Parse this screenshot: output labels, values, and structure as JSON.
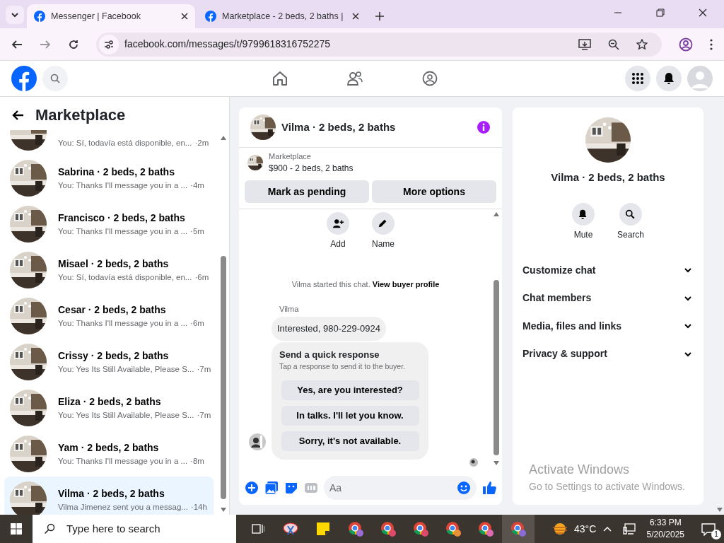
{
  "browser": {
    "tabs": [
      {
        "title": "Messenger | Facebook",
        "selected": true
      },
      {
        "title": "Marketplace - 2 beds, 2 baths |",
        "selected": false
      }
    ],
    "url": "facebook.com/messages/t/9799618316752275"
  },
  "sidebar": {
    "title": "Marketplace",
    "conversations": [
      {
        "preview": "You: Sí, todavía está disponible, en...",
        "time": "·2m",
        "selected": false
      },
      {
        "name": "Sabrina · 2 beds, 2 baths",
        "preview": "You: Thanks I'll message you in a ...",
        "time": "·4m",
        "selected": false
      },
      {
        "name": "Francisco · 2 beds, 2 baths",
        "preview": "You: Thanks I'll message you in a ...",
        "time": "·5m",
        "selected": false
      },
      {
        "name": "Misael · 2 beds, 2 baths",
        "preview": "You: Sí, todavía está disponible, en...",
        "time": "·6m",
        "selected": false
      },
      {
        "name": "Cesar · 2 beds, 2 baths",
        "preview": "You: Thanks I'll message you in a ...",
        "time": "·6m",
        "selected": false
      },
      {
        "name": "Crissy · 2 beds, 2 baths",
        "preview": "You: Yes Its Still Available, Please S...",
        "time": "·7m",
        "selected": false
      },
      {
        "name": "Eliza · 2 beds, 2 baths",
        "preview": "You: Yes Its Still Available, Please S...",
        "time": "·7m",
        "selected": false
      },
      {
        "name": "Yam · 2 beds, 2 baths",
        "preview": "You: Thanks I'll message you in a ...",
        "time": "·8m",
        "selected": false
      },
      {
        "name": "Vilma · 2 beds, 2 baths",
        "preview": "Vilma Jimenez sent you a messag...",
        "time": "·14h",
        "selected": true
      }
    ]
  },
  "chat": {
    "title": "Vilma · 2 beds, 2 baths",
    "listing": {
      "label": "Marketplace",
      "price": "$900 - 2 beds, 2 baths"
    },
    "buttons": [
      "Mark as pending",
      "More options"
    ],
    "actions": [
      {
        "kind": "add",
        "label": "Add"
      },
      {
        "kind": "name",
        "label": "Name"
      }
    ],
    "notice": {
      "text": "Vilma started this chat.",
      "link": "View buyer profile"
    },
    "sender": "Vilma",
    "message": "Interested, 980-229-0924",
    "quick_response": {
      "title": "Send a quick response",
      "subtitle": "Tap a response to send it to the buyer.",
      "options": [
        "Yes, are you interested?",
        "In talks. I'll let you know.",
        "Sorry, it's not available."
      ]
    },
    "composer": {
      "placeholder": "Aa"
    }
  },
  "details": {
    "title": "Vilma · 2 beds, 2 baths",
    "actions": [
      {
        "kind": "mute",
        "label": "Mute"
      },
      {
        "kind": "search",
        "label": "Search"
      }
    ],
    "sections": [
      {
        "label": "Customize chat",
        "expanded": false
      },
      {
        "label": "Chat members",
        "expanded": false
      },
      {
        "label": "Media, files and links",
        "expanded": false
      },
      {
        "label": "Privacy & support",
        "expanded": false
      }
    ]
  },
  "activation": {
    "title": "Activate Windows",
    "subtitle": "Go to Settings to activate Windows."
  },
  "taskbar": {
    "search_placeholder": "Type here to search",
    "temperature": "43°C",
    "time": "6:33 PM",
    "date": "5/20/2025",
    "notifications": "1"
  }
}
